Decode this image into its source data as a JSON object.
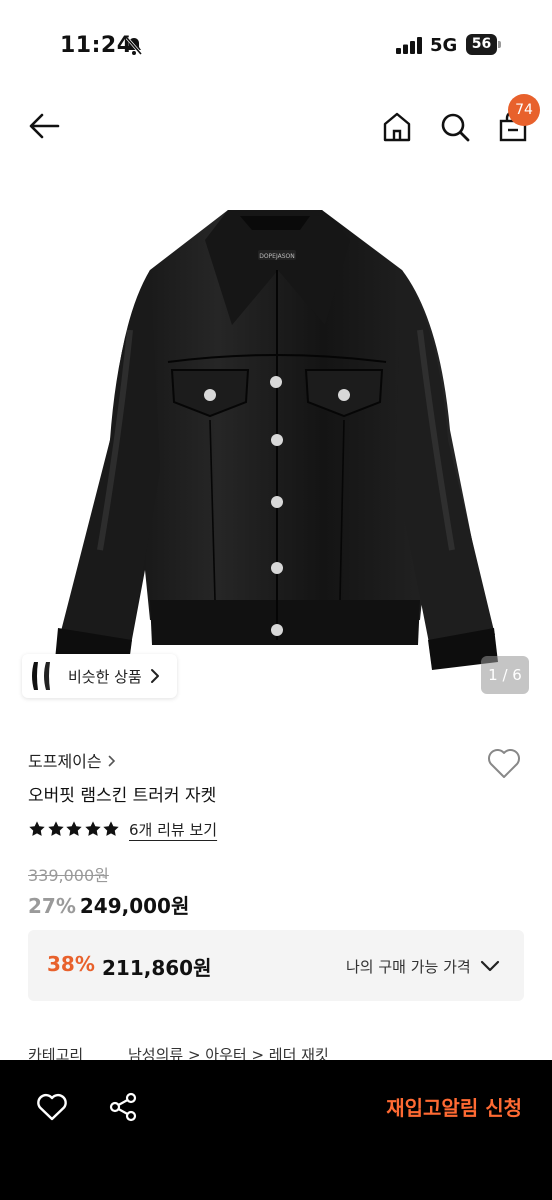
{
  "status_bar": {
    "time": "11:24",
    "network": "5G",
    "battery": "56",
    "icons": [
      "bell-slash-icon",
      "signal-icon",
      "battery-icon"
    ]
  },
  "header": {
    "icons": [
      "back-arrow-icon",
      "home-icon",
      "search-icon",
      "shopping-bag-icon"
    ],
    "cart_count": "74"
  },
  "gallery": {
    "similar_label": "비슷한 상품",
    "pager": "1 / 6"
  },
  "product": {
    "brand": "도프제이슨",
    "name": "오버핏 램스킨 트러커 자켓",
    "rating_stars": 5,
    "review_link": "6개 리뷰 보기",
    "original_price": "339,000원",
    "discount": "27%",
    "sale_price": "249,000원"
  },
  "best_price": {
    "discount": "38%",
    "price": "211,860원",
    "label": "나의 구매 가능 가격"
  },
  "category": {
    "label": "카테고리",
    "path": "남성의류 > 아우터 > 레더 재킷"
  },
  "bottom_bar": {
    "restock_label": "재입고알림 신청"
  },
  "colors": {
    "accent": "#e8612c",
    "bottom_bar_bg": "#000000",
    "restock_text": "#ff6a33"
  }
}
